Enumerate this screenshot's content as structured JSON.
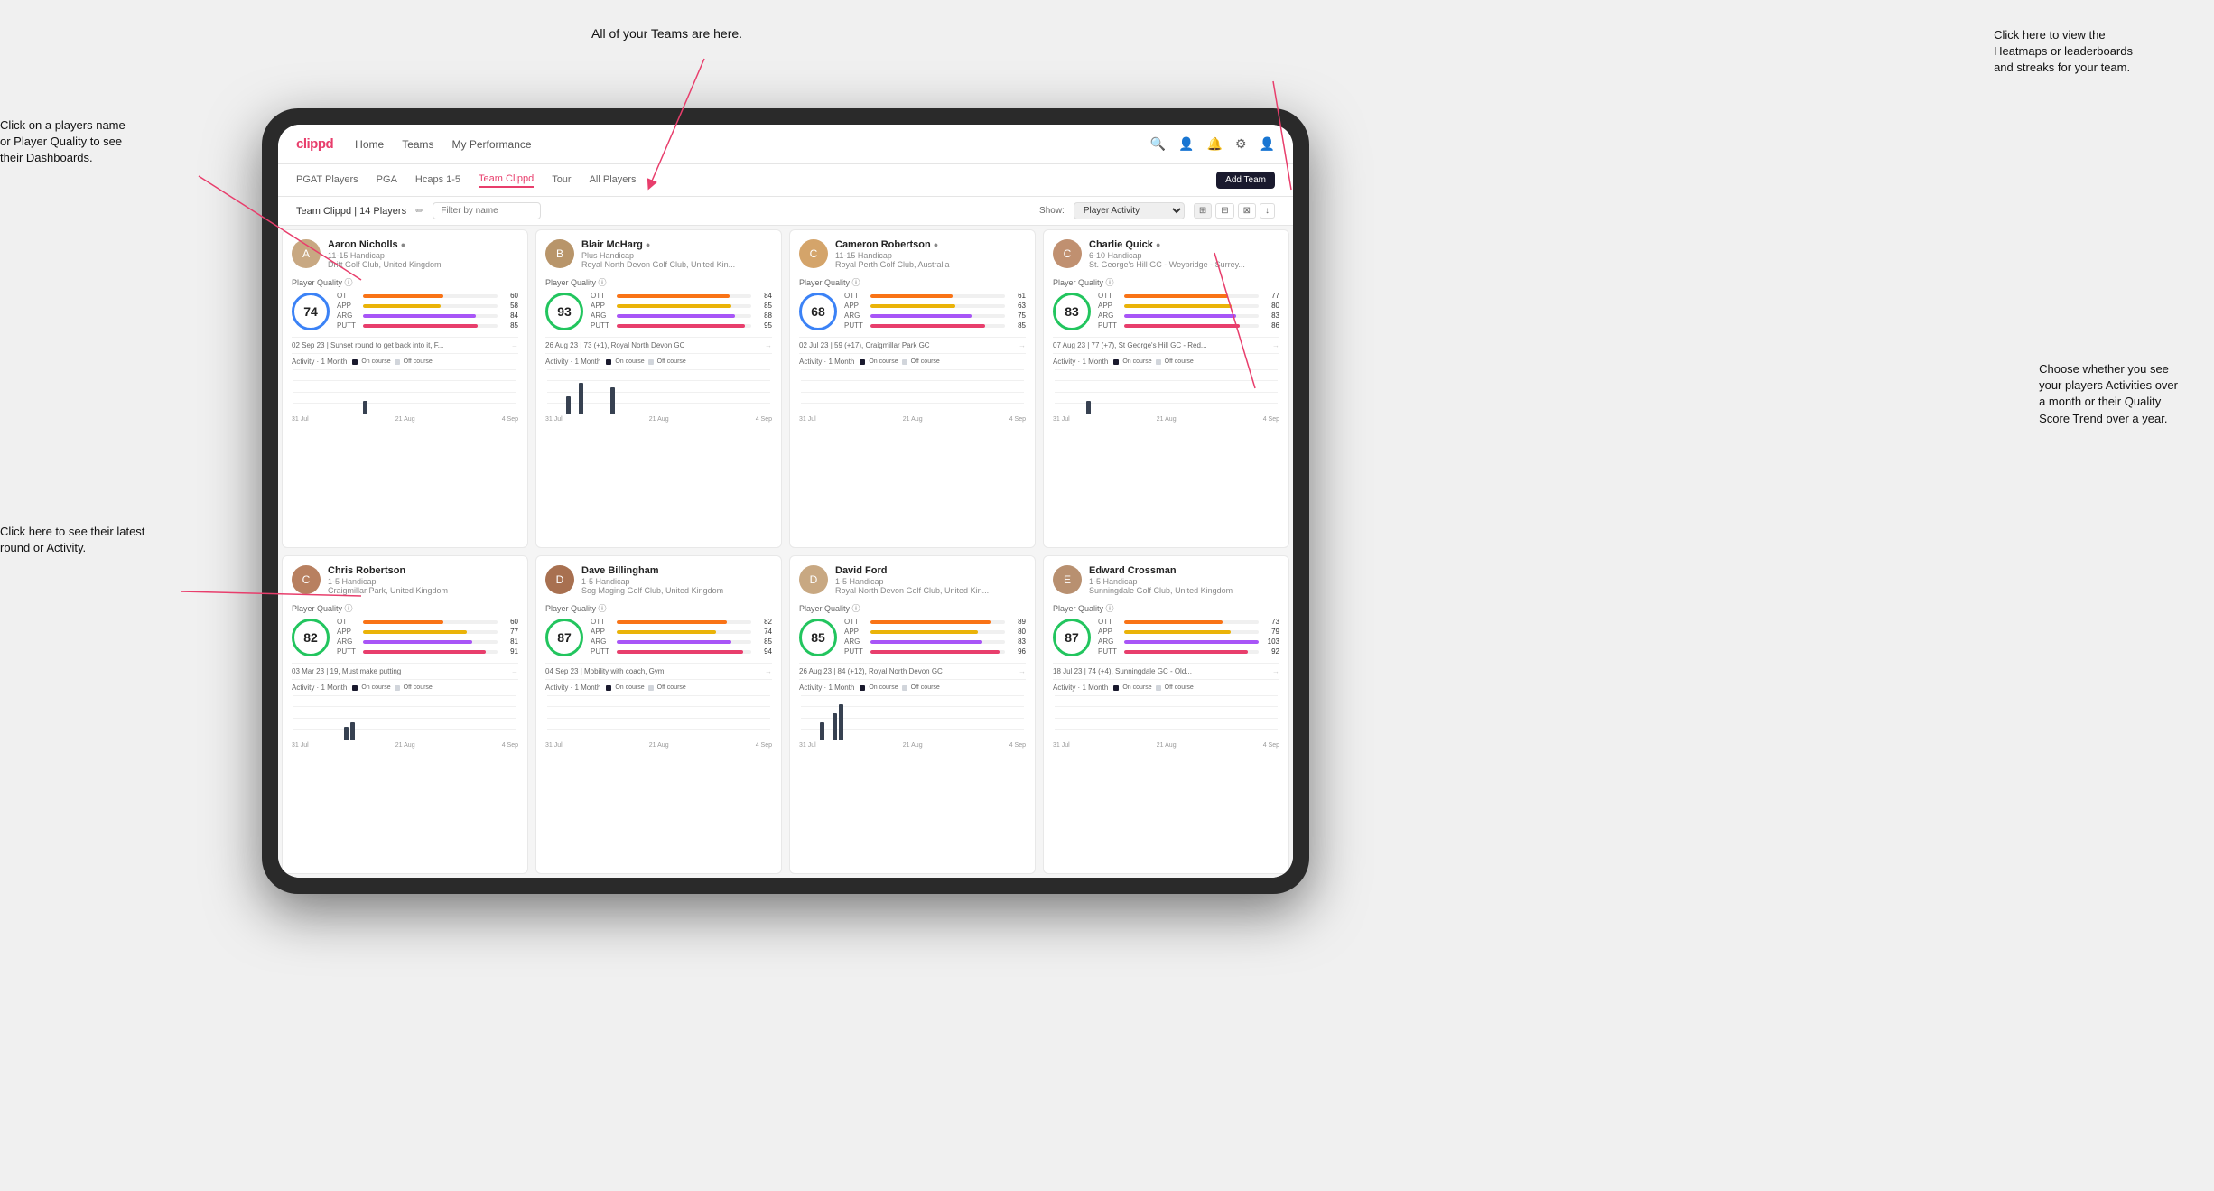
{
  "annotations": {
    "teams": "All of your Teams are here.",
    "heatmaps": "Click here to view the\nHeatmaps or leaderboards\nand streaks for your team.",
    "player_name": "Click on a players name\nor Player Quality to see\ntheir Dashboards.",
    "latest_round": "Click here to see their latest\nround or Activity.",
    "activities": "Choose whether you see\nyour players Activities over\na month or their Quality\nScore Trend over a year."
  },
  "navbar": {
    "logo": "clippd",
    "links": [
      "Home",
      "Teams",
      "My Performance"
    ],
    "icons": [
      "🔍",
      "👤",
      "🔔",
      "⚙",
      "👤"
    ]
  },
  "subnav": {
    "links": [
      "PGAT Players",
      "PGA",
      "Hcaps 1-5",
      "Team Clippd",
      "Tour",
      "All Players"
    ],
    "active": "Team Clippd",
    "add_team": "Add Team"
  },
  "toolbar": {
    "team_label": "Team Clippd | 14 Players",
    "search_placeholder": "Filter by name",
    "show_label": "Show:",
    "show_option": "Player Activity",
    "view_options": [
      "⊞",
      "⊟",
      "⊠",
      "↕"
    ]
  },
  "players": [
    {
      "name": "Aaron Nicholls",
      "handicap": "11-15 Handicap",
      "club": "Drift Golf Club, United Kingdom",
      "score": 74,
      "score_color": "blue",
      "stats": {
        "OTT": 60,
        "APP": 58,
        "ARG": 84,
        "PUTT": 85
      },
      "recent": "02 Sep 23 | Sunset round to get back into it, F...",
      "activity_bars": [
        0,
        0,
        0,
        0,
        0,
        0,
        0,
        0,
        0,
        0,
        0,
        3,
        0
      ],
      "dates": [
        "31 Jul",
        "21 Aug",
        "4 Sep"
      ]
    },
    {
      "name": "Blair McHarg",
      "handicap": "Plus Handicap",
      "club": "Royal North Devon Golf Club, United Kin...",
      "score": 93,
      "score_color": "green",
      "stats": {
        "OTT": 84,
        "APP": 85,
        "ARG": 88,
        "PUTT": 95
      },
      "recent": "26 Aug 23 | 73 (+1), Royal North Devon GC",
      "activity_bars": [
        0,
        0,
        0,
        4,
        0,
        7,
        0,
        0,
        0,
        0,
        6,
        0,
        0
      ],
      "dates": [
        "31 Jul",
        "21 Aug",
        "4 Sep"
      ]
    },
    {
      "name": "Cameron Robertson",
      "handicap": "11-15 Handicap",
      "club": "Royal Perth Golf Club, Australia",
      "score": 68,
      "score_color": "blue",
      "stats": {
        "OTT": 61,
        "APP": 63,
        "ARG": 75,
        "PUTT": 85
      },
      "recent": "02 Jul 23 | 59 (+17), Craigmillar Park GC",
      "activity_bars": [
        0,
        0,
        0,
        0,
        0,
        0,
        0,
        0,
        0,
        0,
        0,
        0,
        0
      ],
      "dates": [
        "31 Jul",
        "21 Aug",
        "4 Sep"
      ]
    },
    {
      "name": "Charlie Quick",
      "handicap": "6-10 Handicap",
      "club": "St. George's Hill GC - Weybridge - Surrey...",
      "score": 83,
      "score_color": "green",
      "stats": {
        "OTT": 77,
        "APP": 80,
        "ARG": 83,
        "PUTT": 86
      },
      "recent": "07 Aug 23 | 77 (+7), St George's Hill GC - Red...",
      "activity_bars": [
        0,
        0,
        0,
        0,
        0,
        3,
        0,
        0,
        0,
        0,
        0,
        0,
        0
      ],
      "dates": [
        "31 Jul",
        "21 Aug",
        "4 Sep"
      ]
    },
    {
      "name": "Chris Robertson",
      "handicap": "1-5 Handicap",
      "club": "Craigmillar Park, United Kingdom",
      "score": 82,
      "score_color": "green",
      "stats": {
        "OTT": 60,
        "APP": 77,
        "ARG": 81,
        "PUTT": 91
      },
      "recent": "03 Mar 23 | 19, Must make putting",
      "activity_bars": [
        0,
        0,
        0,
        0,
        0,
        0,
        0,
        0,
        3,
        4,
        0,
        0,
        0
      ],
      "dates": [
        "31 Jul",
        "21 Aug",
        "4 Sep"
      ]
    },
    {
      "name": "Dave Billingham",
      "handicap": "1-5 Handicap",
      "club": "Sog Maging Golf Club, United Kingdom",
      "score": 87,
      "score_color": "green",
      "stats": {
        "OTT": 82,
        "APP": 74,
        "ARG": 85,
        "PUTT": 94
      },
      "recent": "04 Sep 23 | Mobility with coach, Gym",
      "activity_bars": [
        0,
        0,
        0,
        0,
        0,
        0,
        0,
        0,
        0,
        0,
        0,
        0,
        0
      ],
      "dates": [
        "31 Jul",
        "21 Aug",
        "4 Sep"
      ]
    },
    {
      "name": "David Ford",
      "handicap": "1-5 Handicap",
      "club": "Royal North Devon Golf Club, United Kin...",
      "score": 85,
      "score_color": "green",
      "stats": {
        "OTT": 89,
        "APP": 80,
        "ARG": 83,
        "PUTT": 96
      },
      "recent": "26 Aug 23 | 84 (+12), Royal North Devon GC",
      "activity_bars": [
        0,
        0,
        0,
        4,
        0,
        6,
        8,
        0,
        0,
        0,
        0,
        0,
        0
      ],
      "dates": [
        "31 Jul",
        "21 Aug",
        "4 Sep"
      ]
    },
    {
      "name": "Edward Crossman",
      "handicap": "1-5 Handicap",
      "club": "Sunningdale Golf Club, United Kingdom",
      "score": 87,
      "score_color": "green",
      "stats": {
        "OTT": 73,
        "APP": 79,
        "ARG": 103,
        "PUTT": 92
      },
      "recent": "18 Jul 23 | 74 (+4), Sunningdale GC - Old...",
      "activity_bars": [
        0,
        0,
        0,
        0,
        0,
        0,
        0,
        0,
        0,
        0,
        0,
        0,
        0
      ],
      "dates": [
        "31 Jul",
        "21 Aug",
        "4 Sep"
      ]
    }
  ]
}
